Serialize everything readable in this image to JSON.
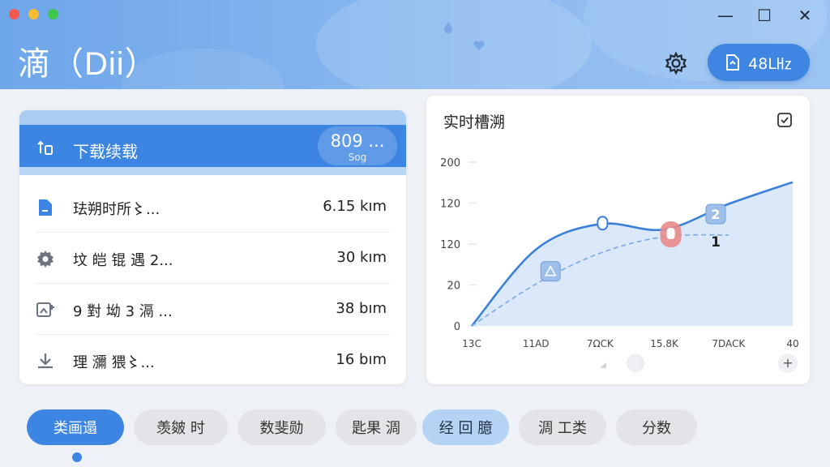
{
  "app": {
    "title": "滴（Dii）"
  },
  "window": {
    "minimize": "—",
    "maximize": "☐",
    "close": "✕"
  },
  "header": {
    "settings_icon": "gear-icon",
    "action_label": "48L㎐",
    "action_icon": "file-icon"
  },
  "list": {
    "header": {
      "label": "下载续载",
      "value": "809 ...",
      "sub": "Sog",
      "icon": "transfer-icon"
    },
    "rows": [
      {
        "name": "珐朔时所〻...",
        "value": "6.15 kım",
        "icon": "document-icon"
      },
      {
        "name": "坟 皑 锟 遇 2...",
        "value": "30 kım",
        "icon": "gear-icon"
      },
      {
        "name": "9 對 坳 3 滆 ...",
        "value": "38 bım",
        "icon": "image-add-icon"
      },
      {
        "name": "理 瀰 猥〻...",
        "value": "16 bım",
        "icon": "download-icon"
      }
    ]
  },
  "chart": {
    "title": "实时槽溯",
    "check_icon": "checkbox-icon",
    "plus_label": "+",
    "marker_label_1": "2",
    "marker_label_2": "1"
  },
  "chart_data": {
    "type": "line",
    "x": [
      "13C",
      "11AD",
      "7ΩCK",
      "15.8K",
      "7DACK",
      "40"
    ],
    "yticks": [
      "0",
      "20",
      "120",
      "120",
      "200"
    ],
    "series": [
      {
        "values": [
          0,
          4.2,
          5.6,
          5.3,
          6.7,
          7.9
        ]
      },
      {
        "values": [
          0,
          2.3,
          4.0,
          4.9,
          5.0
        ]
      }
    ],
    "grid": false,
    "colors": {
      "line": "#3a7fd8",
      "fill": "#cfe0f7",
      "dashed": "#7aa8e6",
      "marker_red": "#e98a8a"
    }
  },
  "tabs": [
    {
      "label": "类画遢",
      "state": "active"
    },
    {
      "label": "羡皴 时",
      "state": "normal"
    },
    {
      "label": "数斐勋",
      "state": "normal"
    },
    {
      "label": "匙果 淍",
      "state": "normal"
    },
    {
      "label": "经 回 臆",
      "state": "soft"
    },
    {
      "label": "淍 工类",
      "state": "normal"
    },
    {
      "label": "分数",
      "state": "normal"
    }
  ],
  "colors": {
    "accent": "#3d85e2",
    "header_start": "#6ea6ea",
    "header_end": "#9cc4f2",
    "background": "#eef1f6"
  }
}
